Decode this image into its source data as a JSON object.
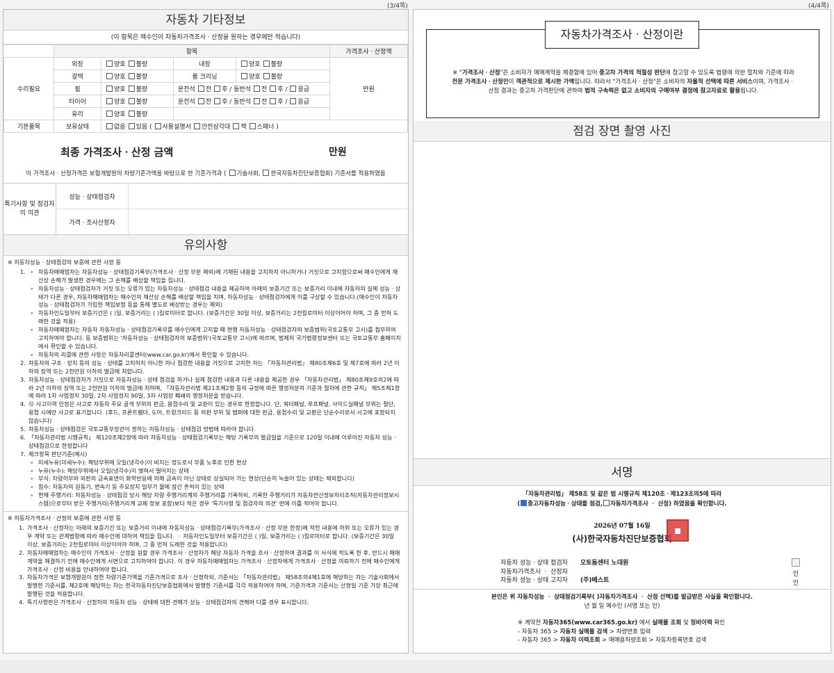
{
  "pages": {
    "left": "(3/4쪽)",
    "right": "(4/4쪽)"
  },
  "left": {
    "title": "자동차 기타정보",
    "subtitle": "(이 항목은 매수인이 자동차가격조사ㆍ산정을 원하는 경우에만 적습니다)",
    "table": {
      "col_item": "항목",
      "col_price": "가격조사ㆍ산정액",
      "group_repair": "수리필요",
      "group_basic": "기본품목",
      "price_value": "만원",
      "good": "양호",
      "bad": "불량",
      "none": "없음",
      "exists": "있음 (",
      "exterior": "외장",
      "interior": "내장",
      "gloss": "광택",
      "roomclean": "룸 크리닝",
      "wheel": "휠",
      "tire": "타이어",
      "glass": "유리",
      "owned": "보유상태",
      "driver_seat": "운전석",
      "passenger_seat": "동반석",
      "front": "전",
      "rear": "후 / ",
      "rear2": "후 /",
      "emergency": "응급",
      "manual": "사용설명서",
      "triangle": "안전삼각대",
      "jack": "잭",
      "spanner": "스패너 )"
    },
    "final_label": "최종 가격조사ㆍ산정 금액",
    "final_unit": "만원",
    "final_note_pre": "이 가격조사ㆍ산정가격은 보험개발원의 차량기준가액을 바탕으로 한 기준가격과 (",
    "final_note_opt1": "기술사회,",
    "final_note_opt2": "한국자동차진단보증협회) 기준서를 적용하였음",
    "opinion": {
      "label": "특기사항 및 점검자의 의견",
      "row1": "성능ㆍ상태점검자",
      "row2": "가격ㆍ조사산정자"
    },
    "notice_title": "유의사항",
    "sec1_head": "※ 자동차성능ㆍ상태점검의 보증에 관한 사항 등",
    "sec1_items": [
      "자동차매매업자는 자동차성능ㆍ상태점검기록부(가격조사ㆍ산정 부분 제외)에 기재된 내용을 고지하지 아니하거나 거짓으로 고지함으로써 매수인에게 재산상 손해가 발생한 경우에는 그 손해를 배상할 책임을 집니다.",
      "자동차성능ㆍ상태점검자가 거짓 또는 오류가 있는 자동차성능ㆍ상태점검 내용을 제공하여 아래의 보증기간 또는 보증거리 이내에 자동차의 실제 성능ㆍ상태가 다른 경우, 자동차매매업자는 매수인의 재산상 손해를 배상할 책임을 지며, 자동차성능ㆍ상태점검자에게 이를 구상할 수 있습니다.(매수인이 자동차성능ㆍ상태점검자가 가입한 책임보험 등을 통해 별도로 배상받는 경우는 제외)",
      "자동차인도일부터 보증기간은 (      )일, 보증거리는 (      )킬로미터로 합니다. (보증기간은 30일 이상, 보증거리는 2천킬로미터 이상이어야 하며, 그 중 먼저 도래한 것을 적용)",
      "자동차매매업자는 자동차 자동차성능ㆍ상태점검기록부를 매수인에게 고지할 때 현행 자동차성능ㆍ상태점검자의 보증범위(국토교통부 고시)를 첨부하여 고지하여야 합니다. 동 보증범위는 '자동차성능ㆍ상태점검자의 보증범위'(국토교통부 고시)에 따르며, 법제처 국가법령정보센터 또는 국토교통부 홈페이지에서 확인할 수 있습니다.",
      "자동차의 리콜에 관한 사항은 자동차리콜센터(www.car.go.kr)에서 확인할 수 있습니다."
    ],
    "sec1_list": [
      "자동차의 구조ㆍ장치 등의 성능ㆍ상태를 고지하지 아니한 자나 점검한 내용을 거짓으로 고지한 자는 「자동차관리법」 제80조제6호 및 제7호에 따라 2년 이하의 징역 또는 2천만원 이하의 벌금에 처합니다.",
      "자동차성능ㆍ상태점검자가 거짓으로 자동차성능ㆍ상태 점검을 하거나 실제 점검한 내용과 다른 내용을 제공한 경우 「자동차관리법」 제80조제9호의2에 따라 2년 이하의 징역 또는 2천만원 이하의 벌금에 처하며, 「자동차관리법 제21조제2항 등의 규정에 따른 행정처분의 기준과 절차에 관한 규칙」 제5조제1항에 따라 1차 사업정지 30일, 2차 사업정지 90일, 3차 사업장 폐쇄의 행정처분을 받습니다.",
      "⑫ 사고이력 인정은 사고로 자동차 주요 골격 부위의 판금, 용접수리 및 교환이 있는 경우로 한정합니다. 단, 쿼터패널, 루프패널, 사이드실패널 부위는 절단, 용접 시에만 사고로 표기합니다. (후드, 프론트휀더, 도어, 트렁크리드 등 외판 부위 및 범퍼에 대한 판금, 용접수리 및 교환은 단순수리로서 사고에 포함되지 않습니다)",
      "자동차성능ㆍ상태점검은 국토교통부장관이 정하는 자동차성능ㆍ상태점검 방법에 따라야 합니다.",
      "「자동차관리법 시행규칙」 제120조제2항에 따라 자동차성능ㆍ상태점검기록부는 해당 기록부의 발급일을 기준으로 120일 이내에 이루어진 자동차 성능ㆍ상태점검으로 한정합니다",
      "체크항목 판단기준(예시)"
    ],
    "sec1_criteria": [
      "미세누유(미세누수): 해당부위에 오일(냉각수)이 비치는 정도로서 부품 노후로 인한 현상",
      "누유(누수): 해당부위에서 오일(냉각수)이 맺혀서 떨어지는 상태",
      "부식: 차량하부와 외판의 금속표면이 화학반응에 의해 금속이 아닌 상태로 상실되어 가는 현상(단순히 녹슬어 있는 상태는 제외합니다)",
      "침수: 자동차의 원동기, 변속기 등 주요장치 일부가 물에 잠긴 흔적이 있는 상태",
      "현재 주행거리: 자동차성능ㆍ상태점검 당시 해당 차량 주행거리계의 주행거리를 기록하되, 기록한 주행거리가 자동차전산정보처리조직(자동차관리정보시스템)으로부터 받은 주행거리(주행거리계 교체 정보 포함)보다 적은 경우 '특기사항 및 점검자의 의견' 란에 이를 적어야 합니다."
    ],
    "sec2_head": "※ 자동차가격조사ㆍ산정의 보증에 관한 사항 등",
    "sec2_list": [
      "가격조사ㆍ산정자는 아래의 보증기간 또는 보증거리 이내에 자동차성능ㆍ상태점검기록부(가격조사ㆍ산정 부분 한정)에 적힌 내용에 허위 또는 오류가 있는 경우 계약 또는 관계법령에 따라 매수인에 대하여 책임을 집니다. ㆍ 자동차인도일부터 보증기간은 (      )일, 보증거리는 (      )킬로미터로 합니다. (보증기간은 30일 이상, 보증거리는 2천킬로미터 이상이어야 하며, 그 중 먼저 도래한 것을 적용합니다)",
      "자동차매매업자는 매수인이 가격조사ㆍ산정을 원할 경우 가격조사ㆍ산정자가 해당 자동차 가격을 조사ㆍ산정하여 결과를 이 서식에 적도록 한 후, 반드시 매매계약을 체결하기 전에 매수인에게 서면으로 고지하여야 합니다. 이 경우 자동차매매업자는 가격조사ㆍ산정자에게 가격조사ㆍ산정을 의뢰하기 전에 매수인에게 가격조사ㆍ산정 비용을 안내하여야 합니다.",
      "자동차가격은 보험개발원이 정한 차량기준가액을 기준가격으로 조사ㆍ산정하되, 기준서는 「자동차관리법」 제58조의4제1호에 해당하는 자는 기술사회에서 발행한 기준서를, 제2호에 해당하는 자는 한국자동차진단보증협회에서 발행한 기준서를 각각 적용하여야 하며, 기준가격과 기준서는 산정일 기준 가장 최근에 발행된 것을 적용합니다.",
      "특기사항란은 가격조사ㆍ산정자의 자동차 성능ㆍ상태에 대한 견해가 성능ㆍ상태점검자의 견해와 다를 경우 표시합니다."
    ]
  },
  "right": {
    "intro_title": "자동차가격조사ㆍ산정이란",
    "intro": {
      "p1": "※ \"",
      "b1": "가격조사ㆍ산정",
      "p2": "\"은 소비자가 매매계약을 체결함에 있어 ",
      "b2": "중고차 가격의 적절성 판단",
      "p3": "에 참고할 수 있도록 법령에 의한 절차와 기준에 따라 ",
      "b3": "전문 가격조사ㆍ산정인",
      "p4": "이 ",
      "b4": "객관적으로 제시한 가액",
      "p5": "입니다. 따라서 \"가격조사ㆍ산정\"은 소비자의 ",
      "b5": "자율적 선택에 따른 서비스",
      "p6": "이며, 가격조사ㆍ산정 결과는 중고차 가격판단에 관하여 ",
      "b6": "법적 구속력은 없고 소비자의 구매여부 결정에 참고자료로 활용",
      "p7": "됩니다."
    },
    "photo_title": "점검 장면 촬영 사진",
    "sign_title": "서명",
    "law_line1": "「자동차관리법」 제58조 및 같은 법 시행규칙 제120조ㆍ제123조의5에 따라",
    "law_open": "(",
    "law_opt1": "중고자동차성능ㆍ상태를 점검,",
    "law_opt2": "자동차가격조사 ㆍ 산정) 하였음을 확인합니다.",
    "date": "2026년 07월  16일",
    "org": "(사)한국자동차진단보증협회",
    "signers": [
      {
        "k": "자동차 성능ㆍ상태 점검자",
        "v": "오토돔센터 노대원"
      },
      {
        "k": "자동차가격조사 ㆍ 산정자",
        "v": ""
      },
      {
        "k": "자동차 성능ㆍ상태 고지자",
        "v": "(주)베스트"
      }
    ],
    "seal_label": "인",
    "confirm_line1": "본인은 위 자동차성능 ㆍ 상태점검기록부(  )자동차가격조사 ㆍ 산정 선택)를 발급받은 사실을 확인합니다.",
    "confirm_line2": "년    월    일    매수인               (서명 또는 인)",
    "tip1_pre": "※ 계약전 ",
    "tip1_b1": "자동차365(www.car365.go.kr)",
    "tip1_mid": " 에서 ",
    "tip1_b2": "실매물 조회",
    "tip1_and": " 및 ",
    "tip1_b3": "정비이력",
    "tip1_post": " 확인",
    "tip2_pre": "- 자동차 365 > ",
    "tip2_b": "자동차 실매물 검색",
    "tip2_post": " > 차량번호 입력",
    "tip3_pre": "- 자동차 365 > ",
    "tip3_b": "자동차 이력조회",
    "tip3_post": " > 매매용차량조회 > 자동차등록번호 검색"
  }
}
